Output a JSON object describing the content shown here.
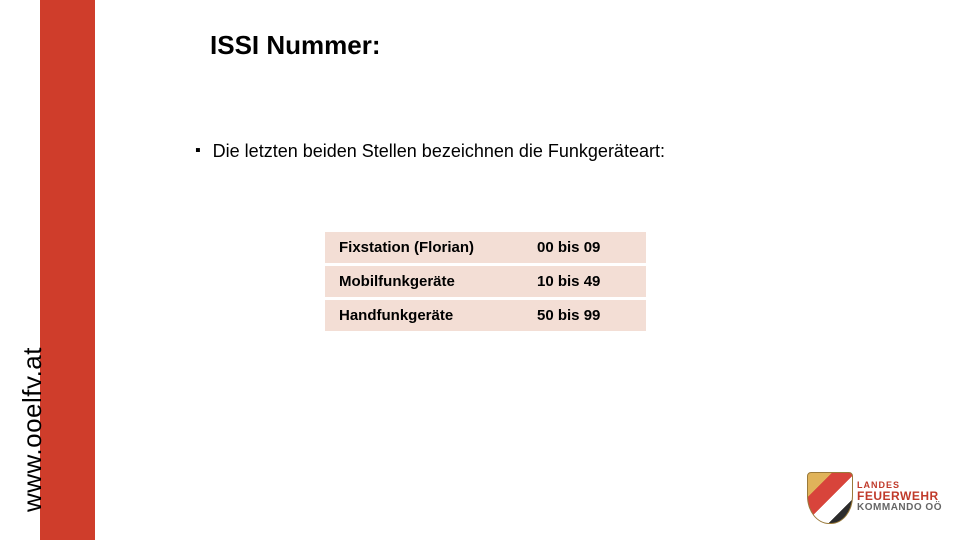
{
  "title": "ISSI Nummer:",
  "bullet": "Die letzten beiden Stellen bezeichnen die Funkgeräteart:",
  "table": {
    "rows": [
      {
        "label": "Fixstation (Florian)",
        "range": "00 bis 09"
      },
      {
        "label": "Mobilfunkgeräte",
        "range": "10 bis 49"
      },
      {
        "label": "Handfunkgeräte",
        "range": "50 bis 99"
      }
    ]
  },
  "sidebar_url": "www.ooelfv.at",
  "logo": {
    "line1": "LANDES",
    "line2": "FEUERWEHR",
    "line3": "KOMMANDO OÖ"
  }
}
